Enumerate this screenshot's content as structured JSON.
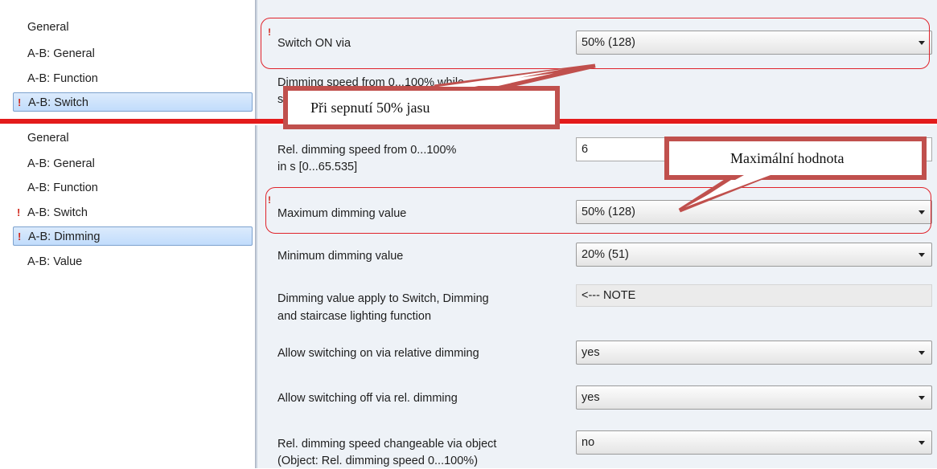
{
  "top": {
    "nav": [
      "General",
      "A-B: General",
      "A-B: Function",
      "A-B: Switch"
    ],
    "selected_index": 3,
    "switch_on_via_label": "Switch ON via",
    "switch_on_via_value": "50%   (128)",
    "cut_label_line1": "Dimming speed from 0...100% while",
    "cut_label_line2": "sw"
  },
  "bottom": {
    "nav": [
      "General",
      "A-B: General",
      "A-B: Function",
      "A-B: Switch",
      "A-B: Dimming",
      "A-B: Value"
    ],
    "selected_index": 4,
    "params": {
      "rel_speed_label_1": "Rel. dimming speed from 0...100%",
      "rel_speed_label_2": "in s [0...65.535]",
      "rel_speed_value": "6",
      "max_label": "Maximum dimming value",
      "max_value": "50%   (128)",
      "min_label": "Minimum dimming value",
      "min_value": "20%   (51)",
      "apply_label_1": "Dimming value apply to Switch, Dimming",
      "apply_label_2": "and staircase lighting function",
      "apply_value": "<--- NOTE",
      "allow_on_label": "Allow switching on via relative dimming",
      "allow_on_value": "yes",
      "allow_off_label": "Allow switching off via rel. dimming",
      "allow_off_value": "yes",
      "changeable_label_1": "Rel. dimming speed changeable via object",
      "changeable_label_2": "(Object: Rel. dimming speed 0...100%)",
      "changeable_value": "no"
    }
  },
  "callouts": {
    "switch_note": "Při sepnutí 50% jasu",
    "max_note": "Maximální hodnota"
  },
  "colors": {
    "accent_red": "#e31b1b",
    "callout_border": "#c0504d",
    "selection_blue": "#c1dcfc"
  }
}
